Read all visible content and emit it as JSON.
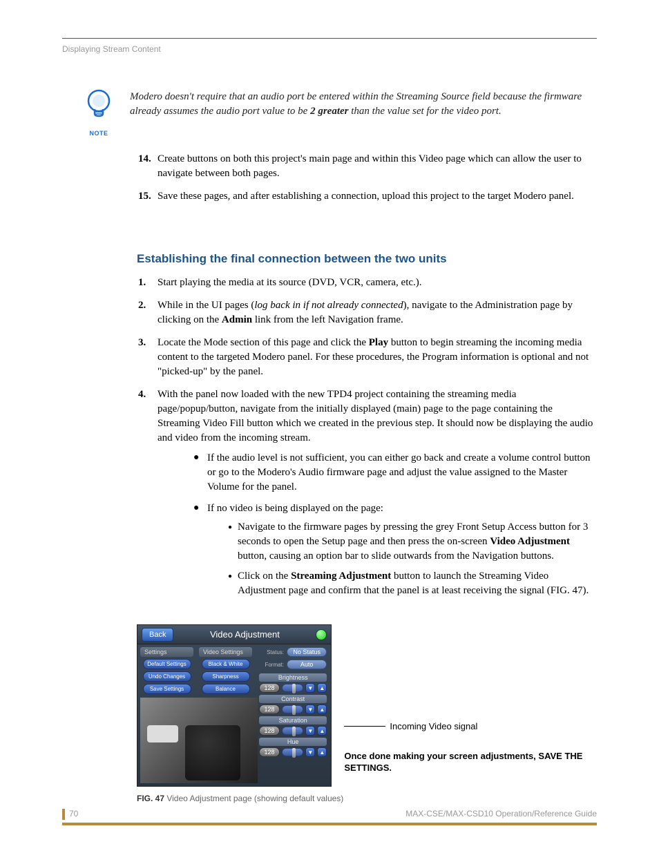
{
  "header": {
    "section": "Displaying Stream Content"
  },
  "note": {
    "label": "NOTE",
    "text_pre": "Modero doesn't require that an audio port be entered within the Streaming Source field because the firmware already assumes the audio port value to be ",
    "text_bold": "2 greater",
    "text_post": " than the value set for the video port."
  },
  "list1": [
    {
      "num": "14.",
      "text": "Create buttons on both this project's main page and within this Video page which can allow the user to navigate between both pages."
    },
    {
      "num": "15.",
      "text": "Save these pages, and after establishing a connection, upload this project to the target Modero panel."
    }
  ],
  "heading": "Establishing the final connection between the two units",
  "list2": {
    "i1": {
      "num": "1.",
      "text": "Start playing the media at its source (DVD, VCR, camera, etc.)."
    },
    "i2": {
      "num": "2.",
      "pre": "While in the UI pages (",
      "italic": "log back in if not already connected",
      "mid": "), navigate to the Administration page by clicking on the ",
      "bold": "Admin",
      "post": " link from the left Navigation frame."
    },
    "i3": {
      "num": "3.",
      "pre": "Locate the Mode section of this page and click the ",
      "bold": "Play",
      "post": " button to begin streaming the incoming media content to the targeted Modero panel. For these procedures, the Program information is optional and not \"picked-up\" by the panel."
    },
    "i4": {
      "num": "4.",
      "text": "With the panel now loaded with the new TPD4 project containing the streaming media page/popup/button, navigate from the initially displayed (main) page to the page containing the Streaming Video Fill button which we created in the previous step. It should now be displaying the audio and video from the incoming stream."
    }
  },
  "bullets": {
    "b1": "If the audio level is not sufficient, you can either go back and create a volume control button or go to the Modero's Audio firmware page and adjust the value assigned to the Master Volume for the panel.",
    "b2": "If no video is being displayed on the page:"
  },
  "subbullets": {
    "s1": {
      "pre": "Navigate to the firmware pages by pressing the grey Front Setup Access button for 3 seconds to open the Setup page and then press the on-screen ",
      "bold": "Video Adjustment",
      "post": " button, causing an option bar to slide outwards from the Navigation buttons."
    },
    "s2": {
      "pre": "Click on the ",
      "bold": "Streaming Adjustment",
      "post": " button to launch the Streaming Video Adjustment page and confirm that the panel is at least receiving the signal (FIG. 47)."
    }
  },
  "panel": {
    "back": "Back",
    "title": "Video Adjustment",
    "settings_header": "Settings",
    "video_settings_header": "Video Settings",
    "settings_buttons": [
      "Default Settings",
      "Undo Changes",
      "Save Settings"
    ],
    "vsettings_buttons": [
      "Black & White",
      "Sharpness",
      "Balance"
    ],
    "status_label": "Status:",
    "status_value": "No Status",
    "format_label": "Format:",
    "format_value": "Auto",
    "sliders": [
      {
        "name": "Brightness",
        "value": "128"
      },
      {
        "name": "Contrast",
        "value": "128"
      },
      {
        "name": "Saturation",
        "value": "128"
      },
      {
        "name": "Hue",
        "value": "128"
      }
    ]
  },
  "annotations": {
    "a1": "Incoming Video signal",
    "a2": "Once done making your screen adjustments, SAVE THE SETTINGS."
  },
  "caption": {
    "label": "FIG. 47",
    "text": "  Video Adjustment page (showing default values)"
  },
  "footer": {
    "page": "70",
    "guide": "MAX-CSE/MAX-CSD10 Operation/Reference Guide"
  }
}
